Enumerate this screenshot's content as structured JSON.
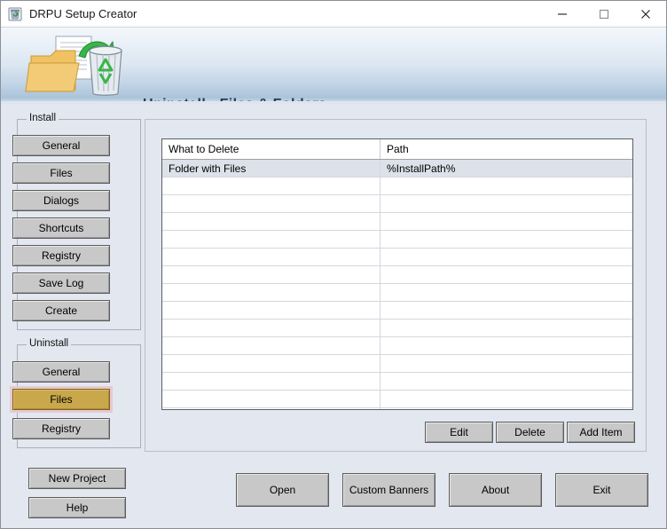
{
  "window": {
    "title": "DRPU Setup Creator",
    "icon": "recycle-bin-icon",
    "minimize_label": "—",
    "maximize_label": "□",
    "close_label": "✕"
  },
  "header": {
    "title": "Uninstall - Files & Folders",
    "icon": "folder-recycle-bin-icon"
  },
  "sidebar": {
    "install_group": {
      "label": "Install",
      "buttons": [
        {
          "label": "General",
          "name": "install-general"
        },
        {
          "label": "Files",
          "name": "install-files"
        },
        {
          "label": "Dialogs",
          "name": "install-dialogs"
        },
        {
          "label": "Shortcuts",
          "name": "install-shortcuts"
        },
        {
          "label": "Registry",
          "name": "install-registry"
        },
        {
          "label": "Save Log",
          "name": "install-save-log"
        },
        {
          "label": "Create",
          "name": "install-create"
        }
      ]
    },
    "uninstall_group": {
      "label": "Uninstall",
      "buttons": [
        {
          "label": "General",
          "name": "uninstall-general",
          "selected": false
        },
        {
          "label": "Files",
          "name": "uninstall-files",
          "selected": true
        },
        {
          "label": "Registry",
          "name": "uninstall-registry",
          "selected": false
        }
      ]
    },
    "project_buttons": [
      {
        "label": "New Project",
        "name": "new-project"
      },
      {
        "label": "Help",
        "name": "help"
      }
    ]
  },
  "table": {
    "columns": [
      "What to Delete",
      "Path"
    ],
    "rows": [
      {
        "what": "Folder with Files",
        "path": "%InstallPath%",
        "selected": true
      }
    ],
    "empty_row_count": 14
  },
  "actions": {
    "edit": "Edit",
    "delete": "Delete",
    "add_item": "Add Item"
  },
  "footer": {
    "open": "Open",
    "custom_banners": "Custom Banners",
    "about": "About",
    "exit": "Exit"
  },
  "colors": {
    "window_bg": "#e2e7f0",
    "button_face": "#c8c8c8",
    "selected_button": "#c9a84c",
    "selected_button_glow": "#e8c9cf",
    "header_title": "#253a57",
    "row_selected": "#dde1e9"
  }
}
